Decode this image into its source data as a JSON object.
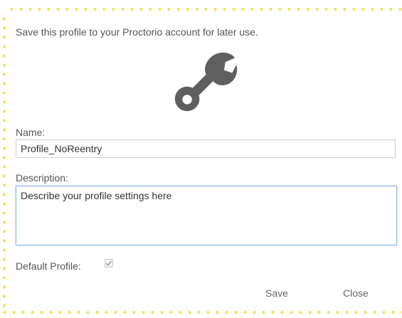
{
  "dialog": {
    "intro_text": "Save this profile to your Proctorio account for later use.",
    "icon": "wrench-icon",
    "border_color": "#f2e24a",
    "icon_color": "#5f5f5f"
  },
  "form": {
    "name_label": "Name:",
    "name_value": "Profile_NoReentry",
    "description_label": "Description:",
    "description_value": "Describe your profile settings here",
    "default_label": "Default Profile:",
    "default_checked": true
  },
  "actions": {
    "save_label": "Save",
    "close_label": "Close"
  }
}
